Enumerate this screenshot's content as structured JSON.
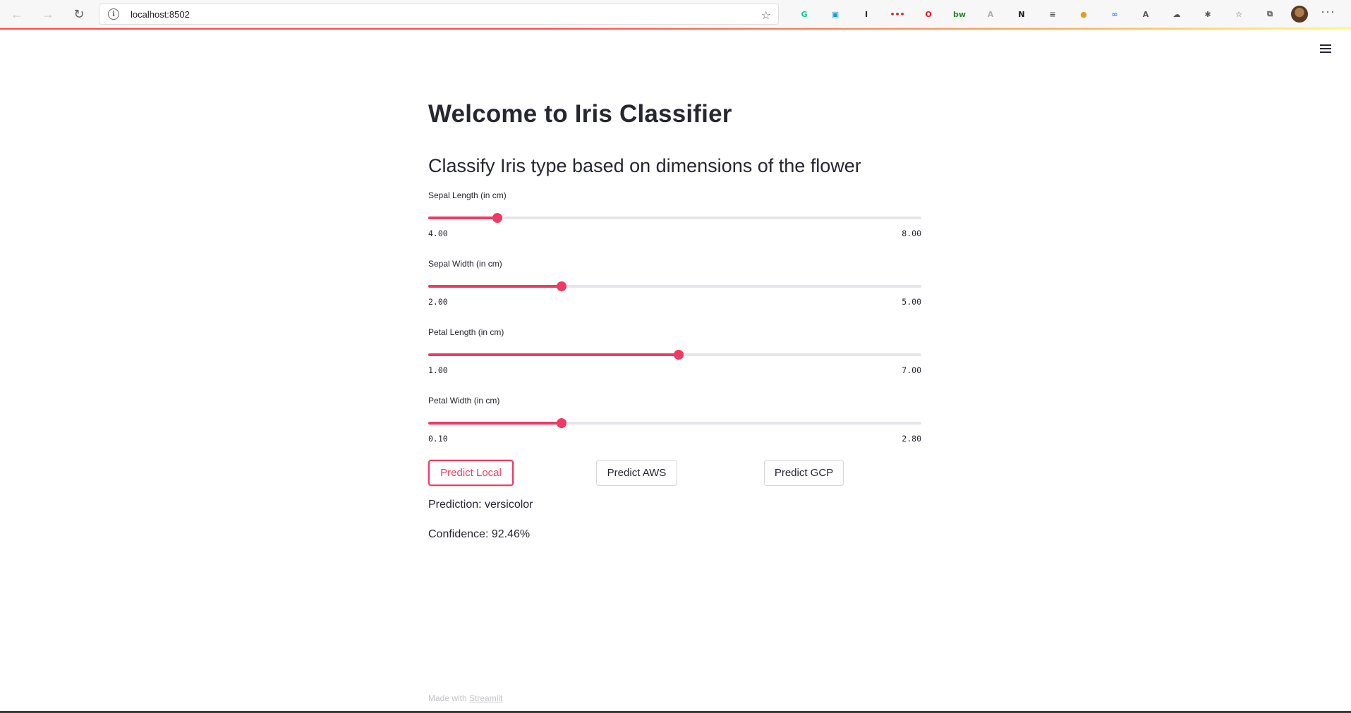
{
  "browser": {
    "url": "localhost:8502",
    "extensions": [
      {
        "name": "grammarly-icon",
        "glyph": "G",
        "color": "#15c39a"
      },
      {
        "name": "save-icon",
        "glyph": "▣",
        "color": "#1a9bd7"
      },
      {
        "name": "instapaper-icon",
        "glyph": "I",
        "color": "#222222"
      },
      {
        "name": "lastpass-icon",
        "glyph": "•••",
        "color": "#d32d27"
      },
      {
        "name": "opera-icon",
        "glyph": "O",
        "color": "#e7131e"
      },
      {
        "name": "bw-icon",
        "glyph": "bw",
        "color": "#2a8a2a"
      },
      {
        "name": "grey-extension-icon",
        "glyph": "A",
        "color": "#b0b0b0"
      },
      {
        "name": "notion-icon",
        "glyph": "N",
        "color": "#111111"
      },
      {
        "name": "reader-icon",
        "glyph": "≡",
        "color": "#555555"
      },
      {
        "name": "cookie-icon",
        "glyph": "●",
        "color": "#e39b2b"
      },
      {
        "name": "sync-icon",
        "glyph": "∞",
        "color": "#2f8de4"
      },
      {
        "name": "read-aloud-icon",
        "glyph": "A",
        "color": "#555555"
      },
      {
        "name": "cloud-icon",
        "glyph": "☁",
        "color": "#555555"
      },
      {
        "name": "puzzle-icon",
        "glyph": "✱",
        "color": "#555555"
      },
      {
        "name": "favorites-icon",
        "glyph": "☆",
        "color": "#555555"
      },
      {
        "name": "collections-icon",
        "glyph": "⧉",
        "color": "#555555"
      }
    ]
  },
  "app": {
    "title": "Welcome to Iris Classifier",
    "subtitle": "Classify Iris type based on dimensions of the flower",
    "accent_color": "#f03a63",
    "sliders": [
      {
        "label": "Sepal Length (in cm)",
        "min": 4.0,
        "max": 8.0,
        "min_text": "4.00",
        "max_text": "8.00",
        "value": 4.56
      },
      {
        "label": "Sepal Width (in cm)",
        "min": 2.0,
        "max": 5.0,
        "min_text": "2.00",
        "max_text": "5.00",
        "value": 2.81
      },
      {
        "label": "Petal Length (in cm)",
        "min": 1.0,
        "max": 7.0,
        "min_text": "1.00",
        "max_text": "7.00",
        "value": 4.05
      },
      {
        "label": "Petal Width (in cm)",
        "min": 0.1,
        "max": 2.8,
        "min_text": "0.10",
        "max_text": "2.80",
        "value": 0.83
      }
    ],
    "buttons": {
      "predict_local": "Predict Local",
      "predict_aws": "Predict AWS",
      "predict_gcp": "Predict GCP"
    },
    "prediction": "Prediction: versicolor",
    "confidence": "Confidence: 92.46%"
  },
  "footer": {
    "made_with": "Made with",
    "link": "Streamlit"
  }
}
